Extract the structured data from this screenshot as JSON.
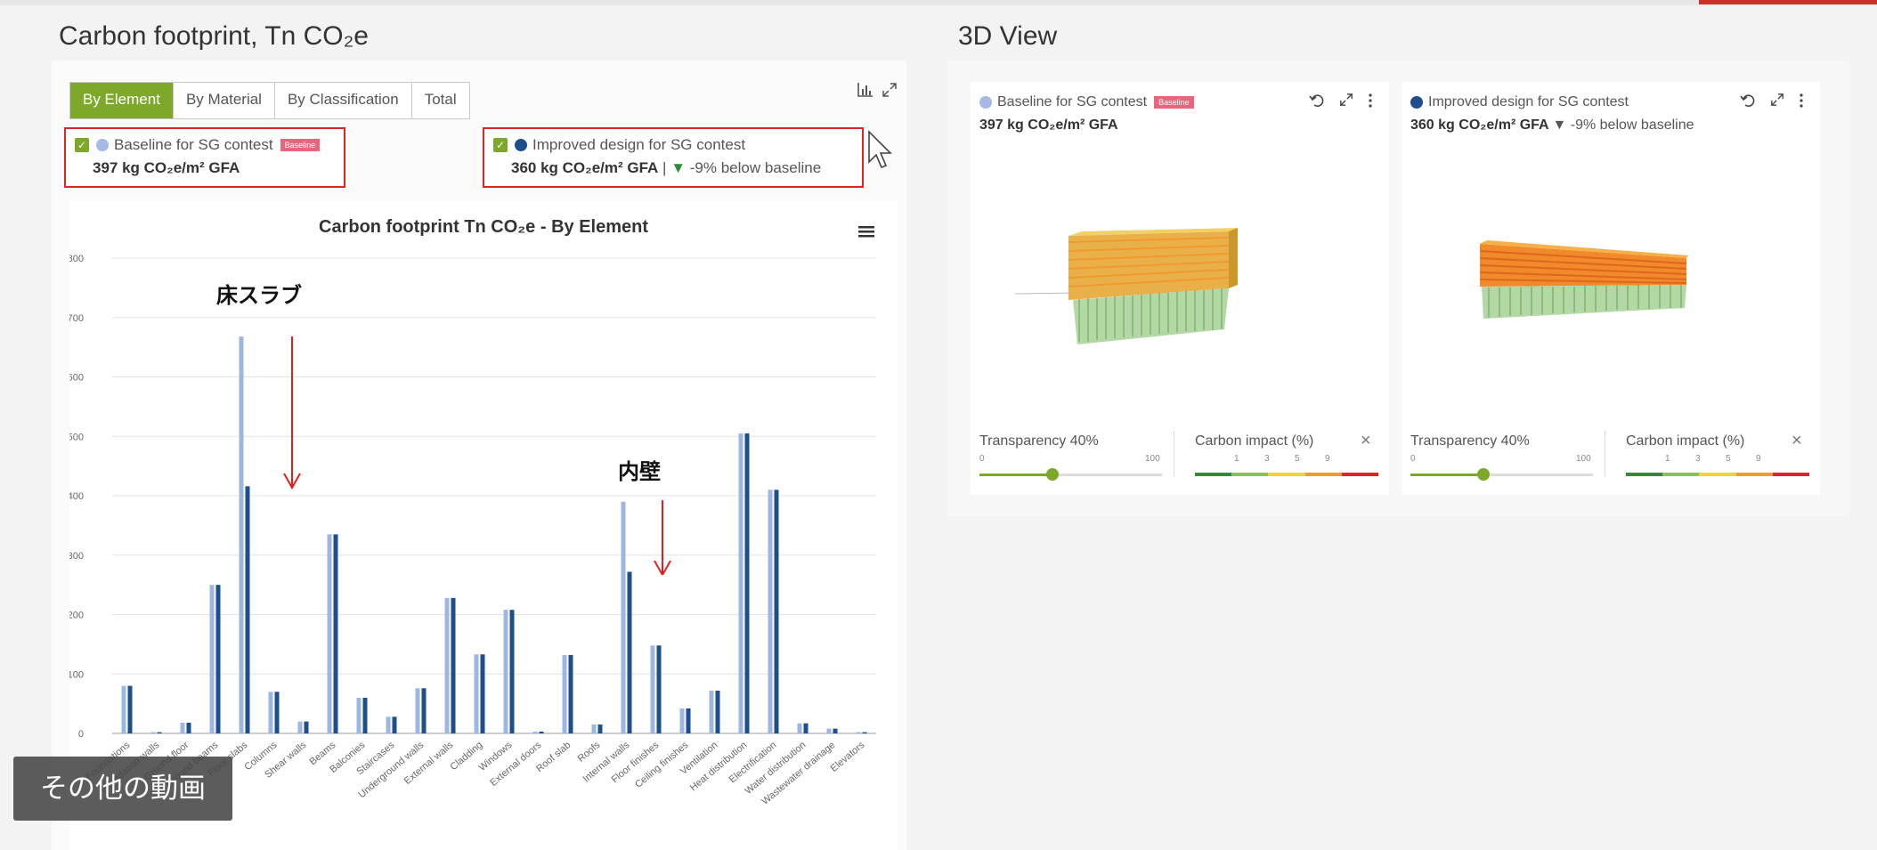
{
  "left": {
    "title": "Carbon footprint, Tn CO₂e",
    "tabs": [
      "By Element",
      "By Material",
      "By Classification",
      "Total"
    ],
    "baseline": {
      "label": "Baseline for SG contest",
      "badge": "Baseline",
      "value": "397 kg CO₂e/m² GFA",
      "color": "#a5b8e6"
    },
    "improved": {
      "label": "Improved design for SG contest",
      "value": "360 kg CO₂e/m² GFA",
      "delta": "-9% below baseline",
      "sep": " | ",
      "arrow": "▼",
      "color": "#1f4e8c"
    },
    "icons": {
      "chart": "bar-chart-icon",
      "expand": "expand-icon",
      "menu": "hamburger-menu-icon"
    }
  },
  "annotations": {
    "floor_slab": "床スラブ",
    "internal_wall": "内壁"
  },
  "overlay": {
    "more_videos": "その他の動画"
  },
  "right": {
    "title": "3D View",
    "cards": [
      {
        "name": "Baseline for SG contest",
        "badge": "Baseline",
        "value": "397 kg CO₂e/m² GFA",
        "delta": "",
        "dot": "#a5b8e6",
        "transparency": "Transparency 40%",
        "t_min": "0",
        "t_max": "100",
        "t_level": 0.4,
        "impact": "Carbon impact (%)",
        "impact_ticks": [
          "1",
          "3",
          "5",
          "9"
        ]
      },
      {
        "name": "Improved design for SG contest",
        "badge": "",
        "value": "360 kg CO₂e/m² GFA",
        "delta": "▼ -9% below baseline",
        "dot": "#1f4e8c",
        "transparency": "Transparency 40%",
        "t_min": "0",
        "t_max": "100",
        "t_level": 0.4,
        "impact": "Carbon impact (%)",
        "impact_ticks": [
          "1",
          "3",
          "5",
          "9"
        ]
      }
    ],
    "icons": [
      "undo-icon",
      "expand-icon",
      "more-vertical-icon"
    ]
  },
  "chart_data": {
    "type": "bar",
    "title": "Carbon footprint Tn CO₂e - By Element",
    "ylim": [
      0,
      800
    ],
    "yticks": [
      0,
      100,
      200,
      300,
      400,
      500,
      600,
      700,
      800
    ],
    "categories": [
      "Foundations",
      "Foundation walls",
      "Ground floor",
      "Ground beams",
      "Floor slabs",
      "Columns",
      "Shear walls",
      "Beams",
      "Balconies",
      "Staircases",
      "Underground walls",
      "External walls",
      "Cladding",
      "Windows",
      "External doors",
      "Roof slab",
      "Roofs",
      "Internal walls",
      "Floor finishes",
      "Ceiling finishes",
      "Ventilation",
      "Heat distribution",
      "Electrification",
      "Water distribution",
      "Wastewater drainage",
      "Elevators"
    ],
    "series": [
      {
        "name": "Baseline for SG contest",
        "color": "#9db7e5",
        "values": [
          80,
          2,
          18,
          250,
          668,
          70,
          20,
          335,
          60,
          28,
          76,
          228,
          133,
          208,
          3,
          132,
          15,
          390,
          148,
          42,
          72,
          505,
          410,
          17,
          8,
          2
        ]
      },
      {
        "name": "Improved design for SG contest",
        "color": "#1f4e8c",
        "values": [
          80,
          2,
          18,
          250,
          416,
          70,
          20,
          335,
          60,
          28,
          76,
          228,
          133,
          208,
          3,
          132,
          15,
          272,
          148,
          42,
          72,
          505,
          410,
          17,
          8,
          2
        ]
      }
    ],
    "grid": true,
    "legend": "none"
  }
}
